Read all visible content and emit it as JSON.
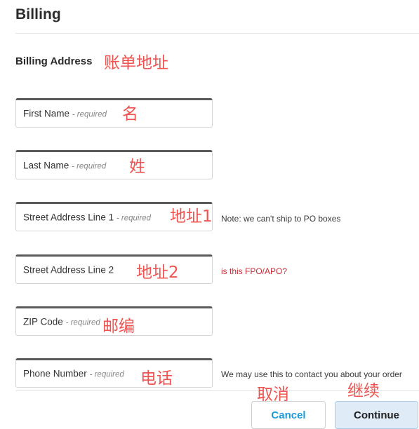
{
  "header": {
    "title": "Billing"
  },
  "section": {
    "heading": "Billing Address"
  },
  "form": {
    "required_suffix": "- required",
    "fields": [
      {
        "name": "first-name",
        "label": "First Name",
        "required": true,
        "value": "",
        "placeholder": "First Name"
      },
      {
        "name": "last-name",
        "label": "Last Name",
        "required": true,
        "value": "",
        "placeholder": "Last Name"
      },
      {
        "name": "street-address-1",
        "label": "Street Address Line 1",
        "required": true,
        "value": "",
        "placeholder": "Street Address Line 1"
      },
      {
        "name": "street-address-2",
        "label": "Street Address Line 2",
        "required": false,
        "value": "",
        "placeholder": "Street Address Line 2"
      },
      {
        "name": "zip-code",
        "label": "ZIP Code",
        "required": true,
        "value": "",
        "placeholder": "ZIP Code"
      },
      {
        "name": "phone-number",
        "label": "Phone Number",
        "required": true,
        "value": "",
        "placeholder": "Phone Number"
      }
    ]
  },
  "notes": {
    "po_box": "Note: we can't ship to PO boxes",
    "fpo_apo": "is this FPO/APO?",
    "phone_contact": "We may use this to contact you about your order"
  },
  "footer": {
    "cancel_label": "Cancel",
    "continue_label": "Continue"
  },
  "annotations": {
    "billing_address": "账单地址",
    "first_name": "名",
    "last_name": "姓",
    "street_1": "地址1",
    "street_2": "地址2",
    "zip": "邮编",
    "phone": "电话",
    "cancel": "取消",
    "continue": "继续"
  },
  "colors": {
    "annotation_red": "#ef5350",
    "link_red": "#c62f38",
    "cancel_text_blue": "#1b9bd8",
    "continue_bg": "#dfecf8",
    "continue_border": "#a9cde8",
    "field_top_border": "#5a5a5a",
    "rule": "#e3e4e6"
  }
}
